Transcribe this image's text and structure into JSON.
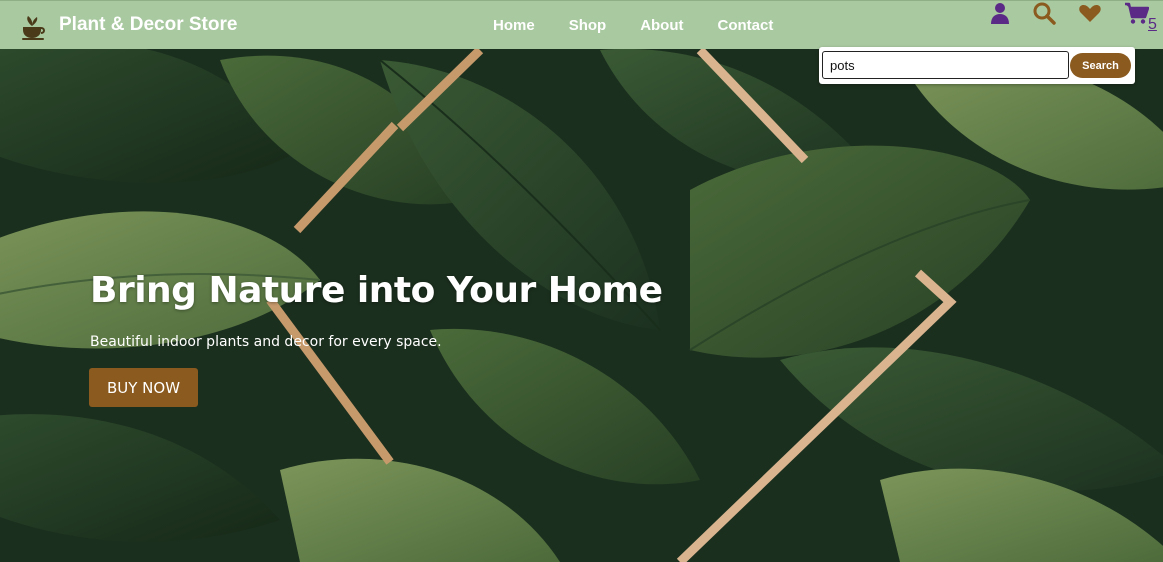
{
  "brand": {
    "name": "Plant & Decor Store",
    "logo_icon": "plant-cup-icon"
  },
  "nav": {
    "links": [
      {
        "label": "Home"
      },
      {
        "label": "Shop"
      },
      {
        "label": "About"
      },
      {
        "label": "Contact"
      }
    ],
    "icons": [
      {
        "name": "user-icon",
        "color": "#5b2a86"
      },
      {
        "name": "search-icon",
        "color": "#8b5a1e"
      },
      {
        "name": "heart-icon",
        "color": "#8b5a1e"
      },
      {
        "name": "cart-icon",
        "color": "#5b2a86"
      }
    ],
    "cart_count": "5"
  },
  "search": {
    "value": "pots",
    "button_label": "Search"
  },
  "hero": {
    "title": "Bring Nature into Your Home",
    "subtitle": "Beautiful indoor plants and decor for every space.",
    "cta_label": "BUY NOW"
  },
  "colors": {
    "navbar_bg": "#a9c9a0",
    "accent_brown": "#8b5a1e",
    "accent_purple": "#5b2a86",
    "frame_tan": "#d9b48f"
  }
}
